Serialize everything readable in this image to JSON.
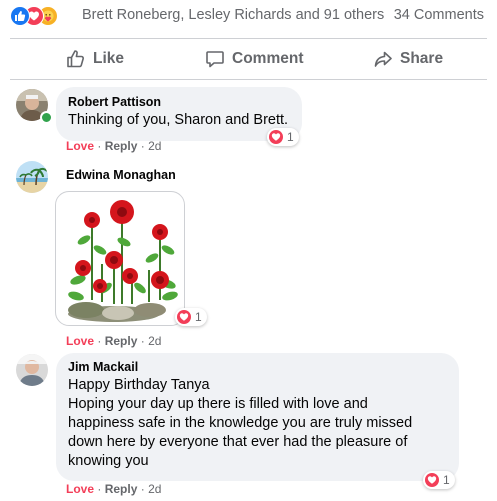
{
  "reaction_summary": {
    "icons": [
      "like-icon",
      "love-icon",
      "care-icon"
    ],
    "names": "Brett Roneberg, Lesley Richards and 91 others",
    "comment_count": "34 Comments"
  },
  "actions": {
    "like": "Like",
    "comment": "Comment",
    "share": "Share"
  },
  "comments": [
    {
      "author": "Robert Pattison",
      "text": "Thinking of you, Sharon and Brett.",
      "love": "Love",
      "reply": "Reply",
      "time": "2d",
      "reaction_count": "1",
      "online": true
    },
    {
      "author": "Edwina Monaghan",
      "sticker": "rose-bush-sticker",
      "love": "Love",
      "reply": "Reply",
      "time": "2d",
      "reaction_count": "1"
    },
    {
      "author": "Jim Mackail",
      "text_lines": [
        "Happy Birthday Tanya",
        "Hoping your day up there is filled with love and",
        "happiness safe in the knowledge you are truly missed",
        "down here by everyone that ever had the pleasure of",
        "knowing you"
      ],
      "love": "Love",
      "reply": "Reply",
      "time": "2d",
      "reaction_count": "1"
    }
  ],
  "colors": {
    "love": "#f33e58",
    "like": "#1877f2",
    "bubble": "#f0f2f5",
    "meta": "#65676b"
  }
}
